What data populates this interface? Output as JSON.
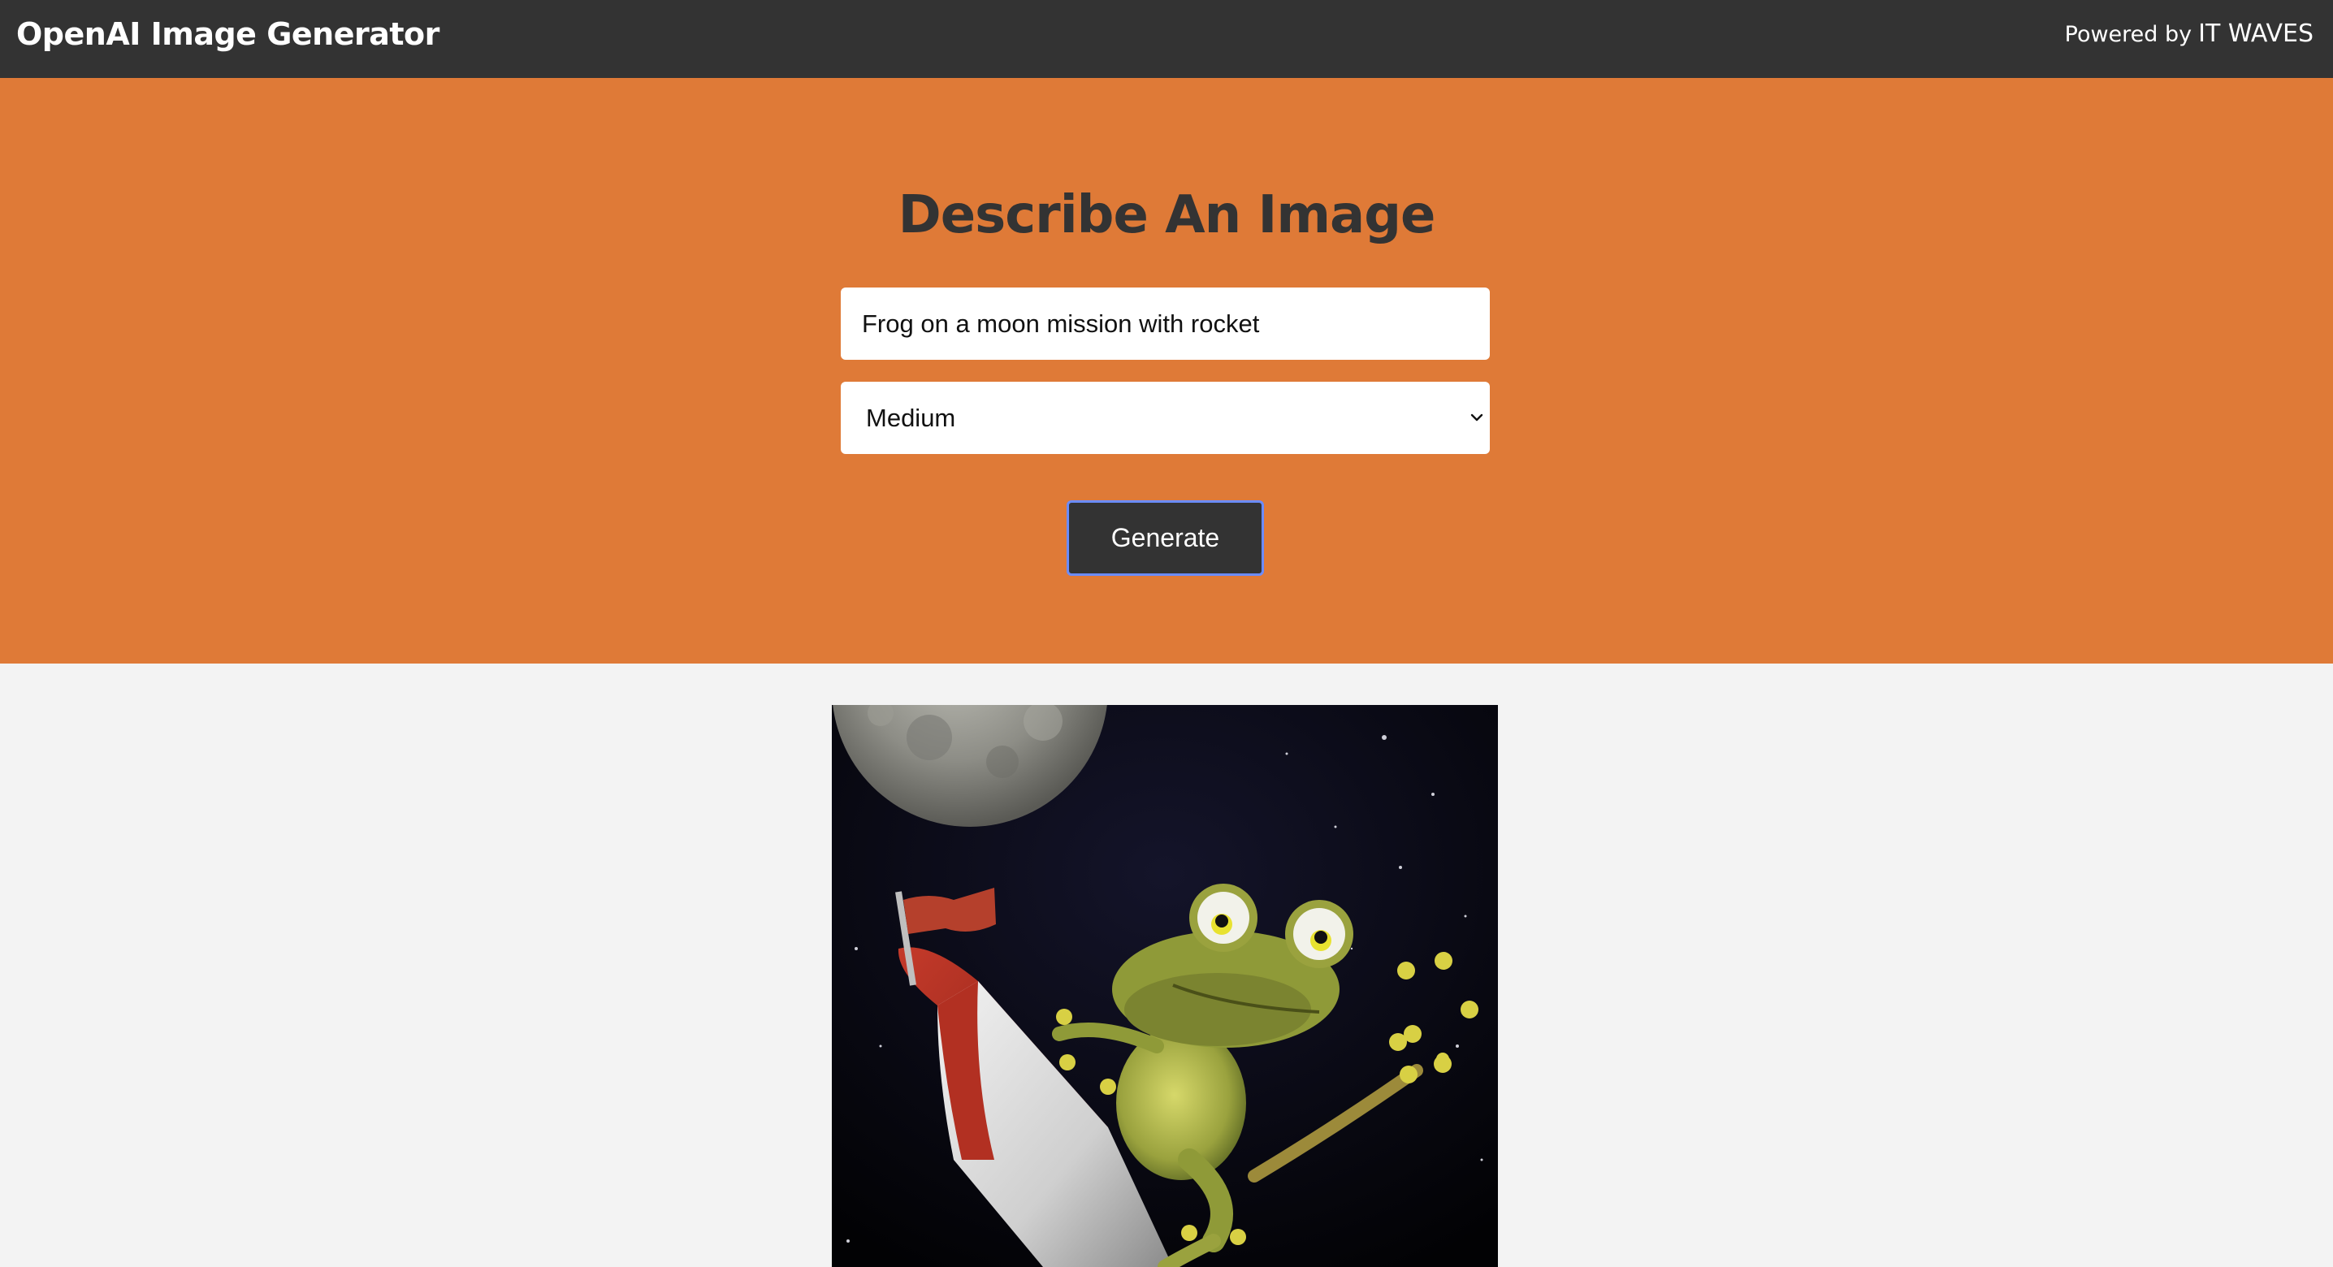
{
  "header": {
    "brand": "OpenAI Image Generator",
    "powered_prefix": "Powered by",
    "powered_company": "IT WAVES"
  },
  "form": {
    "title": "Describe An Image",
    "prompt_value": "Frog on a moon mission with rocket",
    "size_selected": "Medium",
    "generate_label": "Generate"
  },
  "colors": {
    "navbar": "#333333",
    "hero": "#df7a37",
    "page_background": "#f3f3f3",
    "button_border": "#6b8cff"
  },
  "result": {
    "image_subject": "frog riding a red and white rocket in space with the moon"
  }
}
